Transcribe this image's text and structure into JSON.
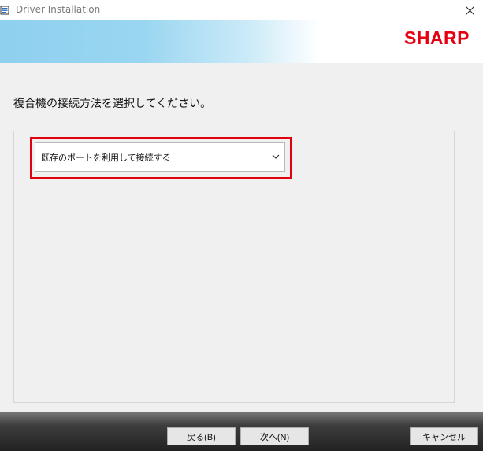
{
  "window": {
    "title": "Driver Installation"
  },
  "banner": {
    "logo_text": "SHARP",
    "logo_color": "#e60012"
  },
  "main": {
    "instruction": "複合機の接続方法を選択してください。",
    "connection_select": {
      "selected_value": "既存のポートを利用して接続する",
      "icon": "chevron-down-icon"
    },
    "highlight_color": "#e00010"
  },
  "footer": {
    "back_label": "戻る(B)",
    "next_label": "次へ(N)",
    "cancel_label": "キャンセル"
  }
}
